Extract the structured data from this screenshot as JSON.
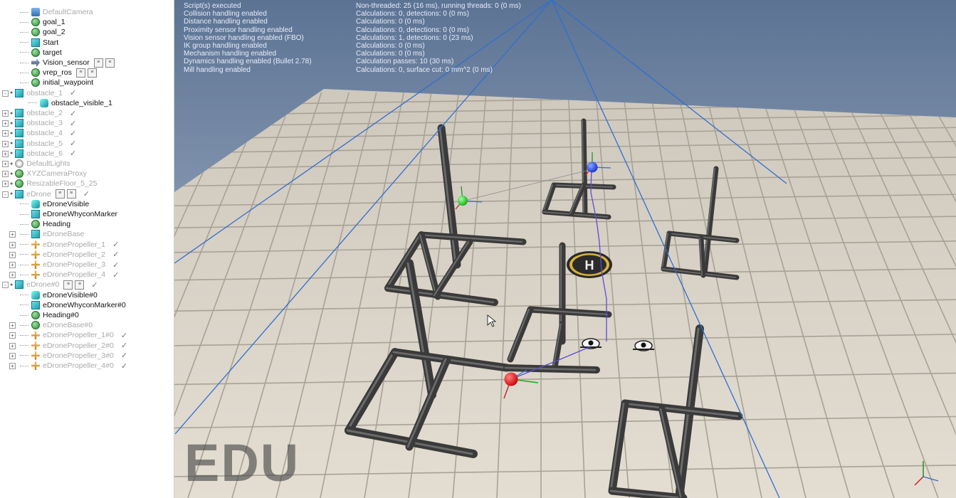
{
  "tree": [
    {
      "label": "DefaultCamera",
      "depth": 2,
      "icon": "camera-icon",
      "dim": true
    },
    {
      "label": "goal_1",
      "depth": 2,
      "icon": "dummy-icon"
    },
    {
      "label": "goal_2",
      "depth": 2,
      "icon": "dummy-icon"
    },
    {
      "label": "Start",
      "depth": 2,
      "icon": "cube-icon"
    },
    {
      "label": "target",
      "depth": 2,
      "icon": "dummy-icon"
    },
    {
      "label": "Vision_sensor",
      "depth": 2,
      "icon": "vision-sensor-icon",
      "scripts": 2
    },
    {
      "label": "vrep_ros",
      "depth": 2,
      "icon": "dummy-icon",
      "scripts": 2
    },
    {
      "label": "initial_waypoint",
      "depth": 2,
      "icon": "dummy-icon"
    },
    {
      "label": "obstacle_1",
      "depth": 1,
      "icon": "cube-icon",
      "dim": true,
      "expand": "-",
      "check": true
    },
    {
      "label": "obstacle_visible_1",
      "depth": 3,
      "icon": "shape-icon"
    },
    {
      "label": "obstacle_2",
      "depth": 1,
      "icon": "cube-icon",
      "dim": true,
      "expand": "+",
      "check": true
    },
    {
      "label": "obstacle_3",
      "depth": 1,
      "icon": "cube-icon",
      "dim": true,
      "expand": "+",
      "check": true
    },
    {
      "label": "obstacle_4",
      "depth": 1,
      "icon": "cube-icon",
      "dim": true,
      "expand": "+",
      "check": true
    },
    {
      "label": "obstacle_5",
      "depth": 1,
      "icon": "cube-icon",
      "dim": true,
      "expand": "+",
      "check": true
    },
    {
      "label": "obstacle_6",
      "depth": 1,
      "icon": "cube-icon",
      "dim": true,
      "expand": "+",
      "check": true
    },
    {
      "label": "DefaultLights",
      "depth": 1,
      "icon": "light-icon",
      "dim": true,
      "expand": "+"
    },
    {
      "label": "XYZCameraProxy",
      "depth": 1,
      "icon": "dummy-icon",
      "dim": true,
      "expand": "+"
    },
    {
      "label": "ResizableFloor_5_25",
      "depth": 1,
      "icon": "dummy-icon",
      "dim": true,
      "expand": "+"
    },
    {
      "label": "eDrone",
      "depth": 1,
      "icon": "cube-icon",
      "dim": true,
      "expand": "-",
      "scripts": 2,
      "check": true
    },
    {
      "label": "eDroneVisible",
      "depth": 2,
      "icon": "shape-icon"
    },
    {
      "label": "eDroneWhyconMarker",
      "depth": 2,
      "icon": "cube-icon"
    },
    {
      "label": "Heading",
      "depth": 2,
      "icon": "dummy-icon"
    },
    {
      "label": "eDroneBase",
      "depth": 2,
      "icon": "cube-icon",
      "dim": true,
      "expand": "+"
    },
    {
      "label": "eDronePropeller_1",
      "depth": 2,
      "icon": "joint-icon",
      "dim": true,
      "expand": "+",
      "check": true
    },
    {
      "label": "eDronePropeller_2",
      "depth": 2,
      "icon": "joint-icon",
      "dim": true,
      "expand": "+",
      "check": true
    },
    {
      "label": "eDronePropeller_3",
      "depth": 2,
      "icon": "joint-icon",
      "dim": true,
      "expand": "+",
      "check": true
    },
    {
      "label": "eDronePropeller_4",
      "depth": 2,
      "icon": "joint-icon",
      "dim": true,
      "expand": "+",
      "check": true
    },
    {
      "label": "eDrone#0",
      "depth": 1,
      "icon": "cube-icon",
      "dim": true,
      "expand": "-",
      "scripts": 2,
      "check": true
    },
    {
      "label": "eDroneVisible#0",
      "depth": 2,
      "icon": "shape-icon"
    },
    {
      "label": "eDroneWhyconMarker#0",
      "depth": 2,
      "icon": "cube-icon"
    },
    {
      "label": "Heading#0",
      "depth": 2,
      "icon": "dummy-icon"
    },
    {
      "label": "eDroneBase#0",
      "depth": 2,
      "icon": "dummy-icon",
      "dim": true,
      "expand": "+"
    },
    {
      "label": "eDronePropeller_1#0",
      "depth": 2,
      "icon": "joint-icon",
      "dim": true,
      "expand": "+",
      "check": true
    },
    {
      "label": "eDronePropeller_2#0",
      "depth": 2,
      "icon": "joint-icon",
      "dim": true,
      "expand": "+",
      "check": true
    },
    {
      "label": "eDronePropeller_3#0",
      "depth": 2,
      "icon": "joint-icon",
      "dim": true,
      "expand": "+",
      "check": true
    },
    {
      "label": "eDronePropeller_4#0",
      "depth": 2,
      "icon": "joint-icon",
      "dim": true,
      "expand": "+",
      "check": true
    }
  ],
  "info": {
    "left": [
      "Script(s) executed",
      "Collision handling enabled",
      "Distance handling enabled",
      "Proximity sensor handling enabled",
      "Vision sensor handling enabled (FBO)",
      "IK group handling enabled",
      "Mechanism handling enabled",
      "Dynamics handling enabled (Bullet 2.78)",
      "Mill handling enabled"
    ],
    "right": [
      "Non-threaded: 25 (16 ms), running threads: 0 (0 ms)",
      "Calculations: 0, detections: 0 (0 ms)",
      "Calculations: 0 (0 ms)",
      "Calculations: 0, detections: 0 (0 ms)",
      "Calculations: 1, detections: 0 (23 ms)",
      "Calculations: 0 (0 ms)",
      "Calculations: 0 (0 ms)",
      "Calculation passes: 10 (30 ms)",
      "Calculations: 0, surface cut: 0 mm^2 (0 ms)"
    ]
  },
  "watermark": "EDU",
  "helipad_letter": "H",
  "colors": {
    "sky_top": "#5c7394",
    "sky_bottom": "#b7c3d3",
    "tile": "#d9d2c6",
    "grout": "#a9a297",
    "pipe": "#3a3a3a",
    "beam": "#2f6fd0"
  }
}
